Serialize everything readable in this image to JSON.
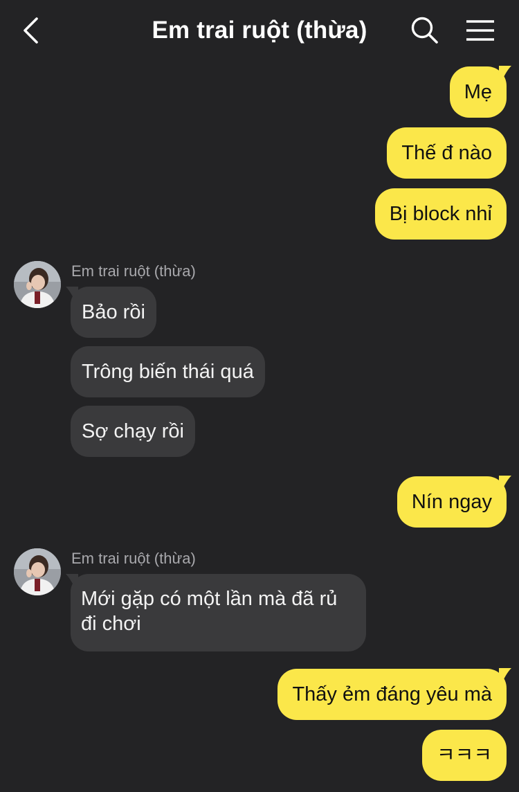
{
  "header": {
    "title": "Em trai ruột (thừa)"
  },
  "icons": {
    "back": "chevron-left-icon",
    "search": "search-icon",
    "menu": "hamburger-menu-icon"
  },
  "colors": {
    "background": "#232325",
    "outgoing_bubble": "#fbe74a",
    "incoming_bubble": "#3a3a3c"
  },
  "messages": {
    "m1": "Mẹ",
    "m2": "Thế đ nào",
    "m3": "Bị block nhỉ",
    "sender1": "Em trai ruột (thừa)",
    "m4": "Bảo rồi",
    "m5": "Trông biến thái quá",
    "m6": "Sợ chạy rồi",
    "m7": "Nín ngay",
    "sender2": "Em trai ruột (thừa)",
    "m8": "Mới gặp có một lần mà đã rủ đi chơi",
    "m9": "Thấy ẻm đáng yêu mà",
    "m10": "ㅋㅋㅋ"
  }
}
